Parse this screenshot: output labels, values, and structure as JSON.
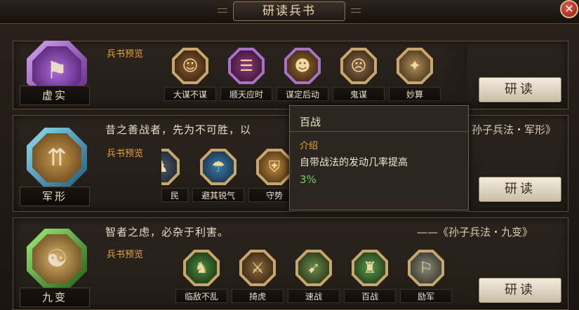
{
  "window": {
    "title": "研读兵书",
    "close_glyph": "✕"
  },
  "sections": [
    {
      "name": "虚实",
      "quote": "",
      "source": "",
      "preview_label": "兵书预览",
      "skills": [
        "大谋不谋",
        "顺天应时",
        "谋定后动",
        "鬼谋",
        "妙算"
      ],
      "button": "研读",
      "colors": {
        "emblem": "#8e3fb5"
      }
    },
    {
      "name": "军形",
      "quote": "昔之善战者，先为不可胜，以",
      "source": "孙子兵法・军形》",
      "preview_label": "兵书预览",
      "skills": [
        "民",
        "避其锐气",
        "守势"
      ],
      "button": "研读",
      "colors": {
        "emblem": "#2c8fb8"
      }
    },
    {
      "name": "九变",
      "quote": "智者之虑，必杂于利害。",
      "source": "——《孙子兵法・九变》",
      "preview_label": "兵书预览",
      "skills": [
        "临敌不乱",
        "掎虎",
        "速战",
        "百战",
        "励军"
      ],
      "button": "研读",
      "colors": {
        "emblem": "#3f9a3a"
      }
    }
  ],
  "tooltip": {
    "title": "百战",
    "section": "介绍",
    "description": "自带战法的发动几率提高",
    "value": "3%"
  },
  "colors": {
    "accent_orange": "#e9a43a",
    "value_green": "#6fd35a"
  }
}
